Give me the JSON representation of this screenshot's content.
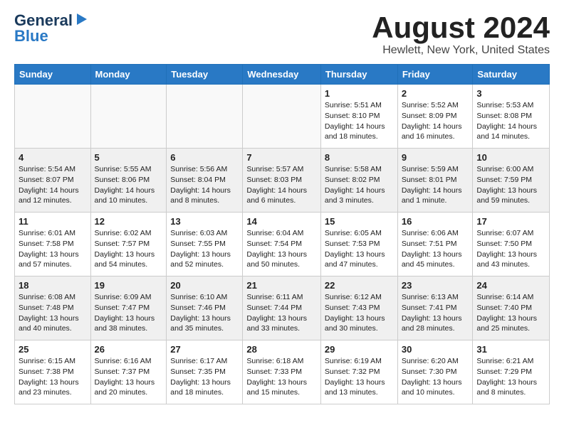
{
  "header": {
    "logo_general": "General",
    "logo_blue": "Blue",
    "month_title": "August 2024",
    "location": "Hewlett, New York, United States"
  },
  "weekdays": [
    "Sunday",
    "Monday",
    "Tuesday",
    "Wednesday",
    "Thursday",
    "Friday",
    "Saturday"
  ],
  "weeks": [
    [
      {
        "day": "",
        "text": ""
      },
      {
        "day": "",
        "text": ""
      },
      {
        "day": "",
        "text": ""
      },
      {
        "day": "",
        "text": ""
      },
      {
        "day": "1",
        "text": "Sunrise: 5:51 AM\nSunset: 8:10 PM\nDaylight: 14 hours\nand 18 minutes."
      },
      {
        "day": "2",
        "text": "Sunrise: 5:52 AM\nSunset: 8:09 PM\nDaylight: 14 hours\nand 16 minutes."
      },
      {
        "day": "3",
        "text": "Sunrise: 5:53 AM\nSunset: 8:08 PM\nDaylight: 14 hours\nand 14 minutes."
      }
    ],
    [
      {
        "day": "4",
        "text": "Sunrise: 5:54 AM\nSunset: 8:07 PM\nDaylight: 14 hours\nand 12 minutes."
      },
      {
        "day": "5",
        "text": "Sunrise: 5:55 AM\nSunset: 8:06 PM\nDaylight: 14 hours\nand 10 minutes."
      },
      {
        "day": "6",
        "text": "Sunrise: 5:56 AM\nSunset: 8:04 PM\nDaylight: 14 hours\nand 8 minutes."
      },
      {
        "day": "7",
        "text": "Sunrise: 5:57 AM\nSunset: 8:03 PM\nDaylight: 14 hours\nand 6 minutes."
      },
      {
        "day": "8",
        "text": "Sunrise: 5:58 AM\nSunset: 8:02 PM\nDaylight: 14 hours\nand 3 minutes."
      },
      {
        "day": "9",
        "text": "Sunrise: 5:59 AM\nSunset: 8:01 PM\nDaylight: 14 hours\nand 1 minute."
      },
      {
        "day": "10",
        "text": "Sunrise: 6:00 AM\nSunset: 7:59 PM\nDaylight: 13 hours\nand 59 minutes."
      }
    ],
    [
      {
        "day": "11",
        "text": "Sunrise: 6:01 AM\nSunset: 7:58 PM\nDaylight: 13 hours\nand 57 minutes."
      },
      {
        "day": "12",
        "text": "Sunrise: 6:02 AM\nSunset: 7:57 PM\nDaylight: 13 hours\nand 54 minutes."
      },
      {
        "day": "13",
        "text": "Sunrise: 6:03 AM\nSunset: 7:55 PM\nDaylight: 13 hours\nand 52 minutes."
      },
      {
        "day": "14",
        "text": "Sunrise: 6:04 AM\nSunset: 7:54 PM\nDaylight: 13 hours\nand 50 minutes."
      },
      {
        "day": "15",
        "text": "Sunrise: 6:05 AM\nSunset: 7:53 PM\nDaylight: 13 hours\nand 47 minutes."
      },
      {
        "day": "16",
        "text": "Sunrise: 6:06 AM\nSunset: 7:51 PM\nDaylight: 13 hours\nand 45 minutes."
      },
      {
        "day": "17",
        "text": "Sunrise: 6:07 AM\nSunset: 7:50 PM\nDaylight: 13 hours\nand 43 minutes."
      }
    ],
    [
      {
        "day": "18",
        "text": "Sunrise: 6:08 AM\nSunset: 7:48 PM\nDaylight: 13 hours\nand 40 minutes."
      },
      {
        "day": "19",
        "text": "Sunrise: 6:09 AM\nSunset: 7:47 PM\nDaylight: 13 hours\nand 38 minutes."
      },
      {
        "day": "20",
        "text": "Sunrise: 6:10 AM\nSunset: 7:46 PM\nDaylight: 13 hours\nand 35 minutes."
      },
      {
        "day": "21",
        "text": "Sunrise: 6:11 AM\nSunset: 7:44 PM\nDaylight: 13 hours\nand 33 minutes."
      },
      {
        "day": "22",
        "text": "Sunrise: 6:12 AM\nSunset: 7:43 PM\nDaylight: 13 hours\nand 30 minutes."
      },
      {
        "day": "23",
        "text": "Sunrise: 6:13 AM\nSunset: 7:41 PM\nDaylight: 13 hours\nand 28 minutes."
      },
      {
        "day": "24",
        "text": "Sunrise: 6:14 AM\nSunset: 7:40 PM\nDaylight: 13 hours\nand 25 minutes."
      }
    ],
    [
      {
        "day": "25",
        "text": "Sunrise: 6:15 AM\nSunset: 7:38 PM\nDaylight: 13 hours\nand 23 minutes."
      },
      {
        "day": "26",
        "text": "Sunrise: 6:16 AM\nSunset: 7:37 PM\nDaylight: 13 hours\nand 20 minutes."
      },
      {
        "day": "27",
        "text": "Sunrise: 6:17 AM\nSunset: 7:35 PM\nDaylight: 13 hours\nand 18 minutes."
      },
      {
        "day": "28",
        "text": "Sunrise: 6:18 AM\nSunset: 7:33 PM\nDaylight: 13 hours\nand 15 minutes."
      },
      {
        "day": "29",
        "text": "Sunrise: 6:19 AM\nSunset: 7:32 PM\nDaylight: 13 hours\nand 13 minutes."
      },
      {
        "day": "30",
        "text": "Sunrise: 6:20 AM\nSunset: 7:30 PM\nDaylight: 13 hours\nand 10 minutes."
      },
      {
        "day": "31",
        "text": "Sunrise: 6:21 AM\nSunset: 7:29 PM\nDaylight: 13 hours\nand 8 minutes."
      }
    ]
  ]
}
